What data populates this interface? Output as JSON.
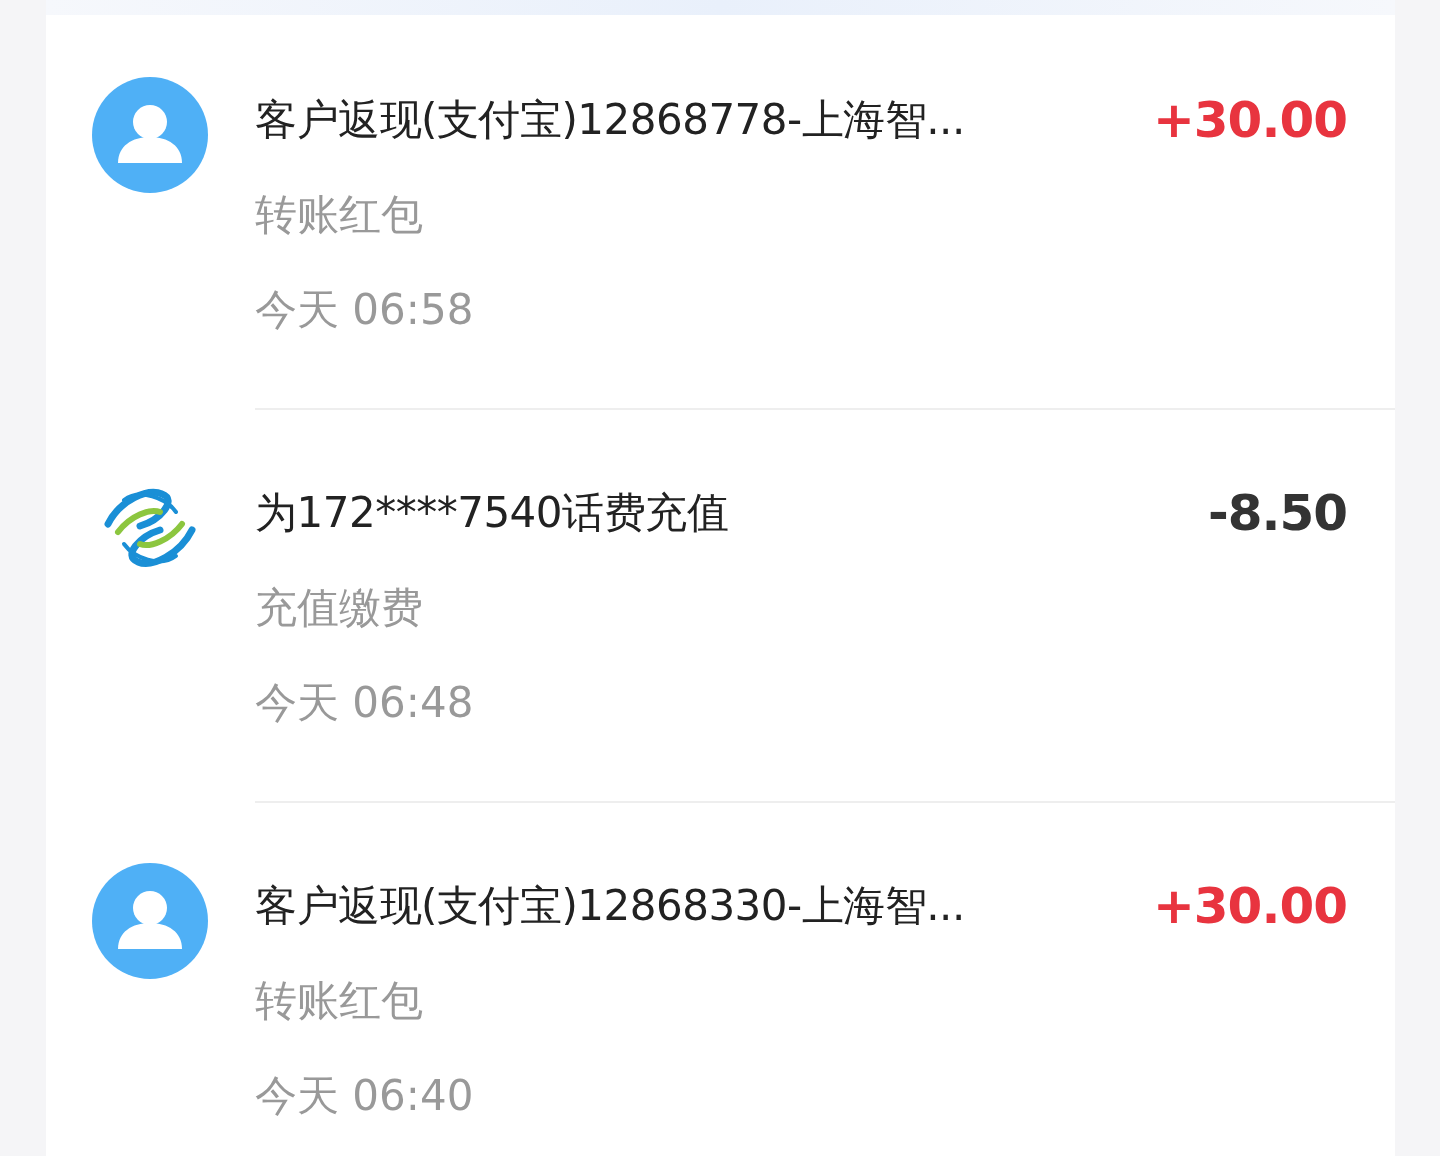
{
  "transactions": [
    {
      "icon": {
        "kind": "avatar"
      },
      "title": "客户返现(支付宝)12868778-上海智...",
      "amount": {
        "text": "+30.00",
        "kind": "income"
      },
      "category": "转账红包",
      "time": "今天 06:58"
    },
    {
      "icon": {
        "kind": "mobile"
      },
      "title": "为172****7540话费充值",
      "amount": {
        "text": "-8.50",
        "kind": "expense"
      },
      "category": "充值缴费",
      "time": "今天 06:48"
    },
    {
      "icon": {
        "kind": "avatar"
      },
      "title": "客户返现(支付宝)12868330-上海智...",
      "amount": {
        "text": "+30.00",
        "kind": "income"
      },
      "category": "转账红包",
      "time": "今天 06:40"
    }
  ]
}
